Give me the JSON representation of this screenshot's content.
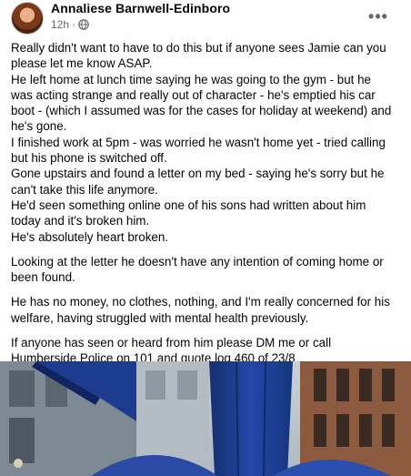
{
  "post": {
    "author": "Annaliese Barnwell-Edinboro",
    "time": "12h",
    "time_sep": "·",
    "privacy_icon": "globe-icon",
    "more_label": "•••",
    "paragraphs": [
      [
        "Really didn't want to have to do this but if anyone sees Jamie can you",
        "please let me know ASAP.",
        "He left home at lunch time saying he was going to the gym - but he",
        "was acting strange and really out of character - he's emptied his car",
        "boot - (which I assumed was for the cases for holiday at weekend) and",
        "he's gone.",
        "I finished work at 5pm - was worried he wasn't home yet - tried calling",
        "but his phone is switched off.",
        "Gone upstairs and found a letter on my bed - saying he's sorry but he",
        "can't take this life anymore.",
        "He'd seen something online one of his sons had written about him",
        "today and it's broken him.",
        "He's absolutely heart broken."
      ],
      [
        "Looking at the letter he doesn't have any intention of coming home or",
        "been found."
      ],
      [
        "He has no money, no clothes, nothing, and I'm really concerned for his",
        "welfare, having struggled with mental health previously."
      ],
      [
        "If anyone has seen or heard from him please DM me or call",
        "Humberside Police on 101 and quote log 460 of 23/8"
      ]
    ]
  },
  "colors": {
    "text": "#050505",
    "meta": "#65676b",
    "umbrella": "#1f3f9a"
  }
}
